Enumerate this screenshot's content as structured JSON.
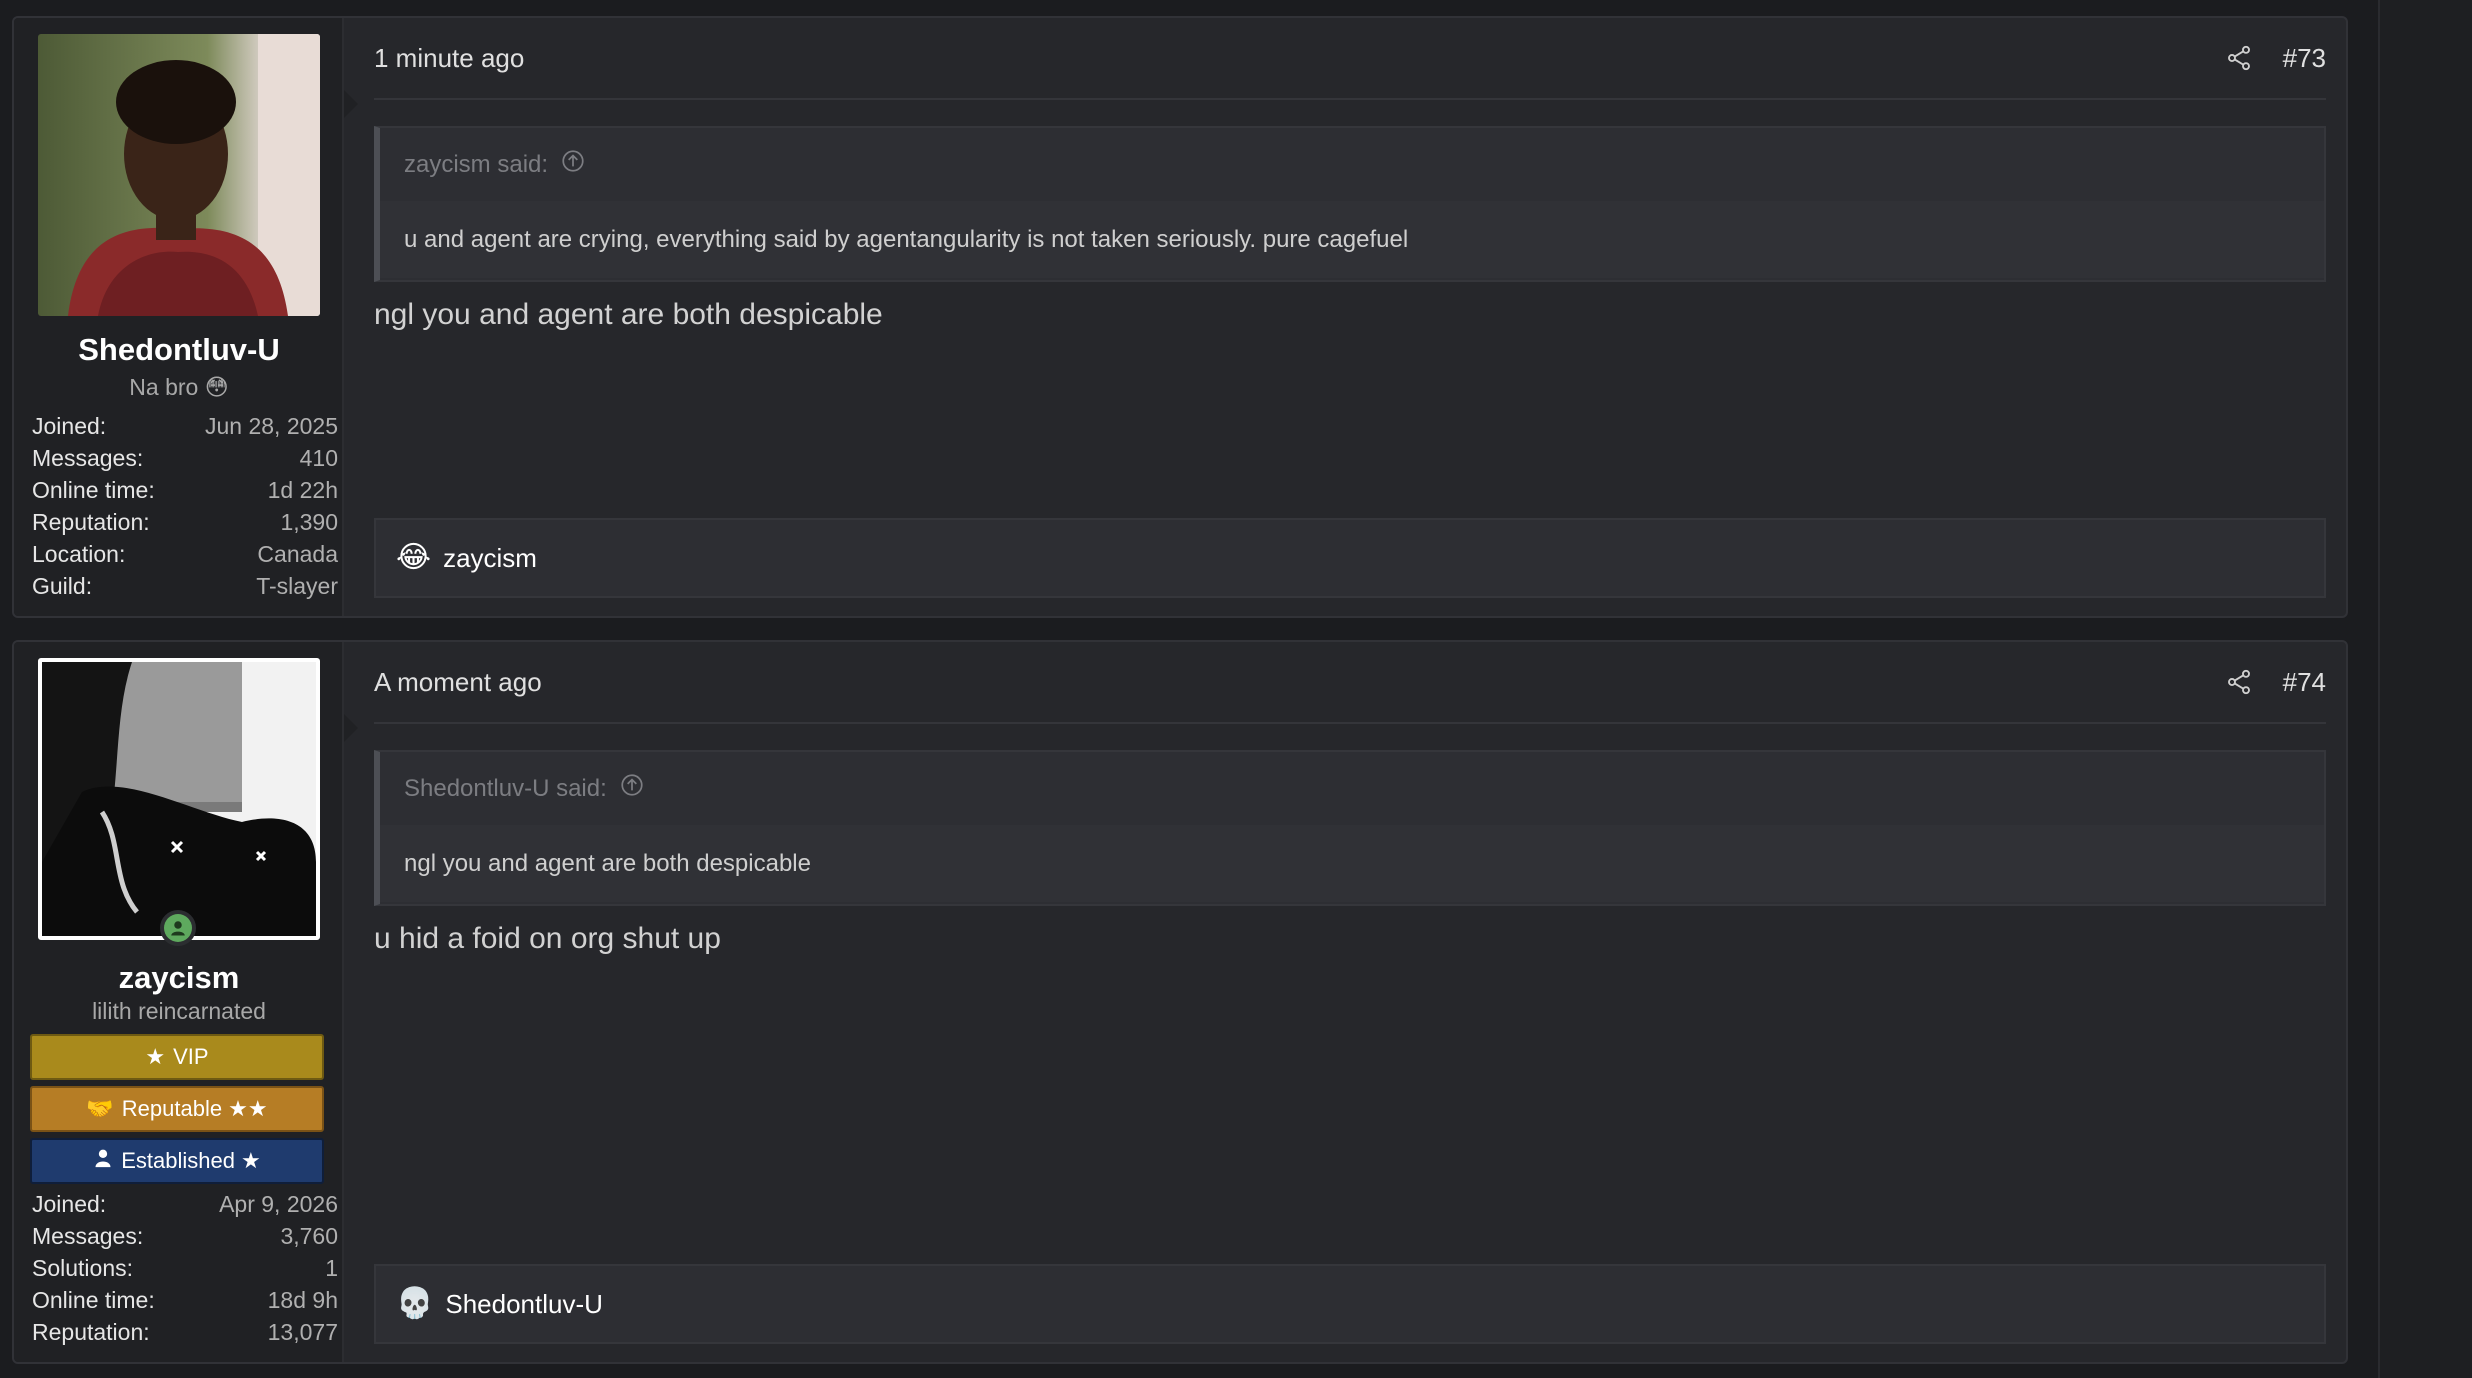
{
  "posts": [
    {
      "username": "Shedontluv-U",
      "usertitle": "Na bro",
      "usertitle_emoji": "😳",
      "stats": [
        {
          "k": "Joined:",
          "v": "Jun 28, 2025"
        },
        {
          "k": "Messages:",
          "v": "410"
        },
        {
          "k": "Online time:",
          "v": "1d 22h"
        },
        {
          "k": "Reputation:",
          "v": "1,390"
        },
        {
          "k": "Location:",
          "v": "Canada"
        },
        {
          "k": "Guild:",
          "v": "T-slayer"
        }
      ],
      "time": "1 minute ago",
      "number": "#73",
      "quote_author": "zaycism said:",
      "quote_text": "u and agent are crying, everything said by agentangularity is not taken seriously. pure cagefuel",
      "message": "ngl you and agent are both despicable",
      "reaction_emoji": "😂",
      "reaction_user": "zaycism"
    },
    {
      "username": "zaycism",
      "usertitle": "lilith reincarnated",
      "banners": {
        "vip": "VIP",
        "reputable": "Reputable ★★",
        "established": "Established ★"
      },
      "stats": [
        {
          "k": "Joined:",
          "v": "Apr 9, 2026"
        },
        {
          "k": "Messages:",
          "v": "3,760"
        },
        {
          "k": "Solutions:",
          "v": "1"
        },
        {
          "k": "Online time:",
          "v": "18d 9h"
        },
        {
          "k": "Reputation:",
          "v": "13,077"
        }
      ],
      "time": "A moment ago",
      "number": "#74",
      "quote_author": "Shedontluv-U said:",
      "quote_text": "ngl you and agent are both despicable",
      "message": "u hid a foid on org shut up",
      "reaction_emoji": "💀",
      "reaction_user": "Shedontluv-U"
    }
  ],
  "colors": {
    "page_bg": "#1b1c1f",
    "post_bg": "#26272b",
    "vip": "#a98a1c",
    "reputable": "#b67d25",
    "established": "#1f3b6e",
    "online": "#5ea95e"
  }
}
